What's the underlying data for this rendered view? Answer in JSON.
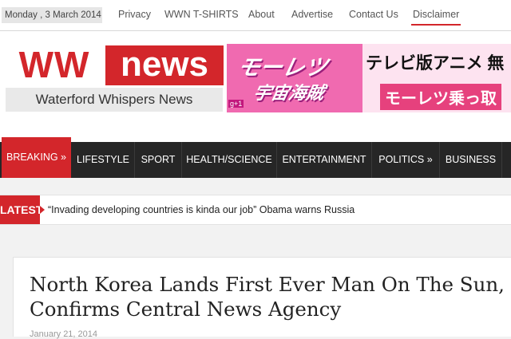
{
  "topbar": {
    "date": "Monday , 3 March 2014",
    "links": [
      "Privacy",
      "WWN T-SHIRTS",
      "About",
      "Advertise",
      "Contact Us",
      "Disclaimer"
    ]
  },
  "logo": {
    "ww": "WW",
    "news": "news",
    "tagline": "Waterford Whispers News"
  },
  "ad": {
    "logo_line1": "モーレツ",
    "logo_line2": "宇宙海賊",
    "badge": "g+1",
    "line1": "テレビ版アニメ 無",
    "line2": "モーレツ乗っ取"
  },
  "nav": {
    "items": [
      "BREAKING »",
      "LIFESTYLE",
      "SPORT",
      "HEALTH/SCIENCE",
      "ENTERTAINMENT",
      "POLITICS »",
      "BUSINESS"
    ]
  },
  "latest": {
    "label": "LATEST",
    "text": "“Invading developing countries is kinda our job” Obama warns Russia"
  },
  "article": {
    "headline": "North Korea Lands First Ever Man On The Sun, Confirms Central News Agency",
    "date": "January 21, 2014"
  },
  "colors": {
    "brand_red": "#d3262b",
    "nav_bg": "#262626",
    "ad_pink": "#f06ab0"
  }
}
